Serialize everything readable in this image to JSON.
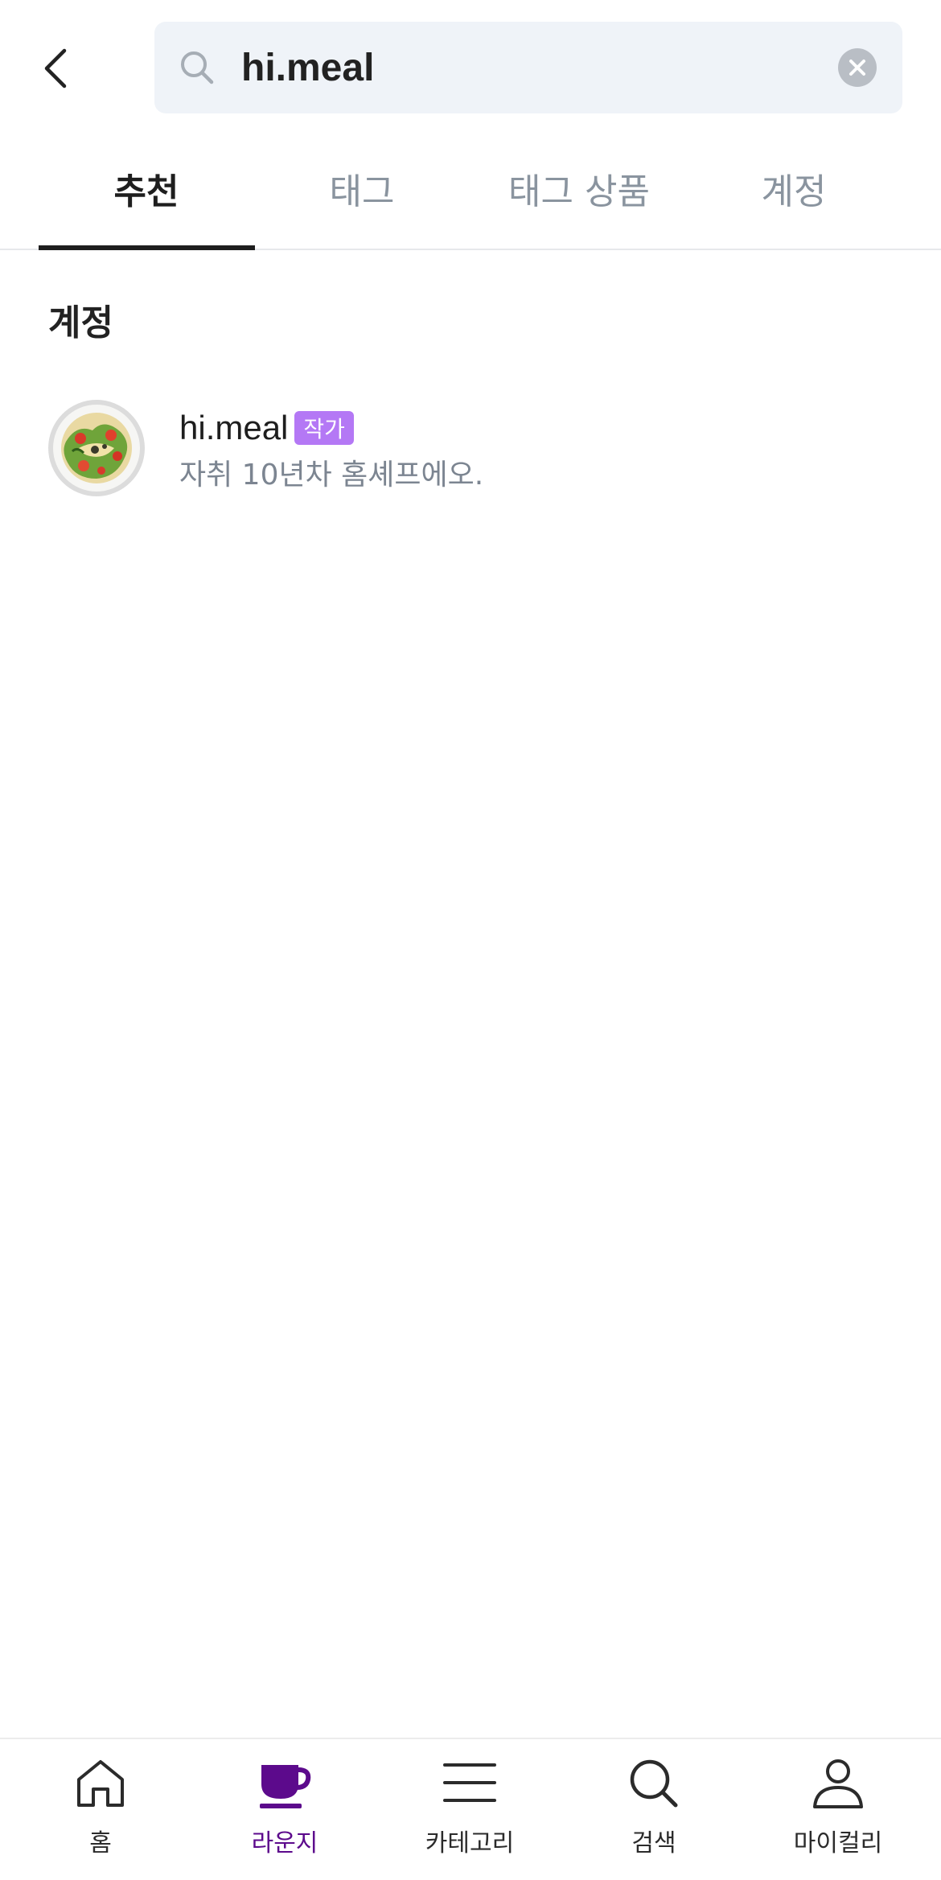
{
  "search": {
    "query": "hi.meal",
    "back_icon": "chevron-left-icon",
    "search_icon": "search-icon",
    "clear_icon": "clear-circle-icon"
  },
  "tabs": [
    {
      "label": "추천",
      "active": true
    },
    {
      "label": "태그",
      "active": false
    },
    {
      "label": "태그 상품",
      "active": false
    },
    {
      "label": "계정",
      "active": false
    }
  ],
  "accounts_section": {
    "title": "계정",
    "items": [
      {
        "name": "hi.meal",
        "badge": "작가",
        "bio": "자취 10년차 홈셰프에오.",
        "avatar_icon": "salad-plate-avatar"
      }
    ]
  },
  "bottom_nav": {
    "items": [
      {
        "label": "홈",
        "icon": "home-icon",
        "active": false
      },
      {
        "label": "라운지",
        "icon": "cup-icon",
        "active": true
      },
      {
        "label": "카테고리",
        "icon": "menu-icon",
        "active": false
      },
      {
        "label": "검색",
        "icon": "search-icon",
        "active": false
      },
      {
        "label": "마이컬리",
        "icon": "user-icon",
        "active": false
      }
    ]
  },
  "colors": {
    "accent_purple": "#5c0a8c",
    "badge_purple": "#b478f5",
    "search_bg": "#eff3f8",
    "inactive_tab": "#8a949f"
  }
}
